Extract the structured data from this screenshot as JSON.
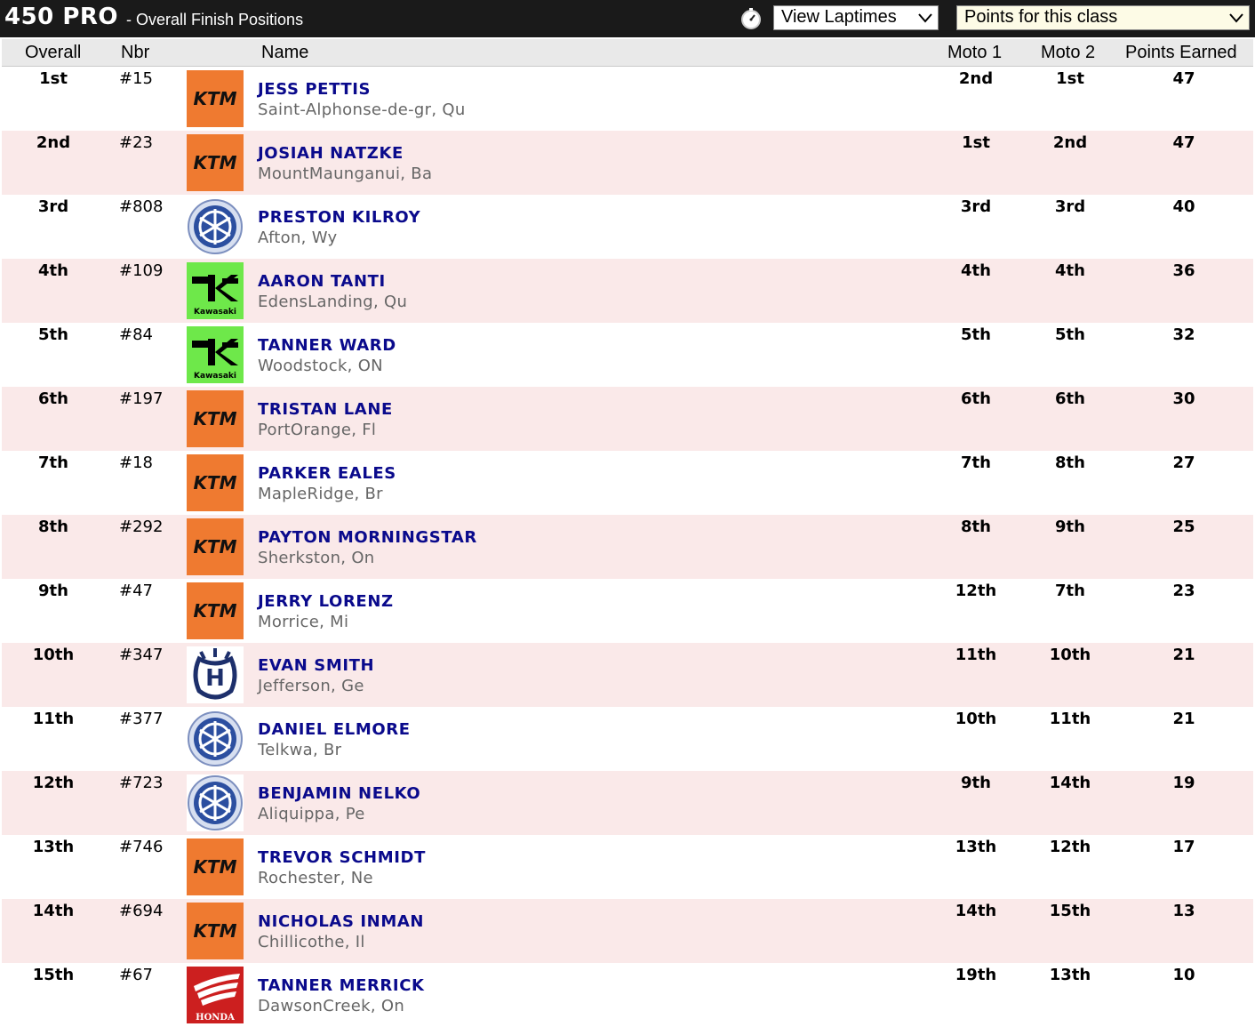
{
  "header": {
    "class_title": "450 PRO",
    "subtitle": "- Overall Finish Positions",
    "timer_icon": "stopwatch-icon",
    "view_dropdown": "View Laptimes",
    "points_dropdown": "Points for this class"
  },
  "columns": {
    "overall": "Overall",
    "nbr": "Nbr",
    "name": "Name",
    "moto1": "Moto 1",
    "moto2": "Moto 2",
    "points": "Points Earned"
  },
  "colors": {
    "ktm": "#ef7a30",
    "kawasaki": "#6ee84a",
    "yamaha": "#2c4fa0",
    "husqvarna": "#1d2f6b",
    "honda": "#cc1f1f",
    "name_text": "#0a0a8c",
    "alt_row": "#fae9e9"
  },
  "rows": [
    {
      "overall": "1st",
      "nbr": "#15",
      "brand": "ktm",
      "name": "JESS PETTIS",
      "location": "Saint-Alphonse-de-gr, Qu",
      "moto1": "2nd",
      "moto2": "1st",
      "points": "47"
    },
    {
      "overall": "2nd",
      "nbr": "#23",
      "brand": "ktm",
      "name": "JOSIAH NATZKE",
      "location": "MountMaunganui, Ba",
      "moto1": "1st",
      "moto2": "2nd",
      "points": "47"
    },
    {
      "overall": "3rd",
      "nbr": "#808",
      "brand": "yamaha",
      "name": "PRESTON KILROY",
      "location": "Afton, Wy",
      "moto1": "3rd",
      "moto2": "3rd",
      "points": "40"
    },
    {
      "overall": "4th",
      "nbr": "#109",
      "brand": "kawasaki",
      "name": "AARON TANTI",
      "location": "EdensLanding, Qu",
      "moto1": "4th",
      "moto2": "4th",
      "points": "36"
    },
    {
      "overall": "5th",
      "nbr": "#84",
      "brand": "kawasaki",
      "name": "TANNER WARD",
      "location": "Woodstock, ON",
      "moto1": "5th",
      "moto2": "5th",
      "points": "32"
    },
    {
      "overall": "6th",
      "nbr": "#197",
      "brand": "ktm",
      "name": "TRISTAN LANE",
      "location": "PortOrange, Fl",
      "moto1": "6th",
      "moto2": "6th",
      "points": "30"
    },
    {
      "overall": "7th",
      "nbr": "#18",
      "brand": "ktm",
      "name": "PARKER EALES",
      "location": "MapleRidge, Br",
      "moto1": "7th",
      "moto2": "8th",
      "points": "27"
    },
    {
      "overall": "8th",
      "nbr": "#292",
      "brand": "ktm",
      "name": "PAYTON MORNINGSTAR",
      "location": "Sherkston, On",
      "moto1": "8th",
      "moto2": "9th",
      "points": "25"
    },
    {
      "overall": "9th",
      "nbr": "#47",
      "brand": "ktm",
      "name": "JERRY LORENZ",
      "location": "Morrice, Mi",
      "moto1": "12th",
      "moto2": "7th",
      "points": "23"
    },
    {
      "overall": "10th",
      "nbr": "#347",
      "brand": "husqvarna",
      "name": "EVAN SMITH",
      "location": "Jefferson, Ge",
      "moto1": "11th",
      "moto2": "10th",
      "points": "21"
    },
    {
      "overall": "11th",
      "nbr": "#377",
      "brand": "yamaha",
      "name": "DANIEL ELMORE",
      "location": "Telkwa, Br",
      "moto1": "10th",
      "moto2": "11th",
      "points": "21"
    },
    {
      "overall": "12th",
      "nbr": "#723",
      "brand": "yamaha",
      "name": "BENJAMIN NELKO",
      "location": "Aliquippa, Pe",
      "moto1": "9th",
      "moto2": "14th",
      "points": "19"
    },
    {
      "overall": "13th",
      "nbr": "#746",
      "brand": "ktm",
      "name": "TREVOR SCHMIDT",
      "location": "Rochester, Ne",
      "moto1": "13th",
      "moto2": "12th",
      "points": "17"
    },
    {
      "overall": "14th",
      "nbr": "#694",
      "brand": "ktm",
      "name": "NICHOLAS INMAN",
      "location": "Chillicothe, Il",
      "moto1": "14th",
      "moto2": "15th",
      "points": "13"
    },
    {
      "overall": "15th",
      "nbr": "#67",
      "brand": "honda",
      "name": "TANNER MERRICK",
      "location": "DawsonCreek, On",
      "moto1": "19th",
      "moto2": "13th",
      "points": "10"
    }
  ]
}
